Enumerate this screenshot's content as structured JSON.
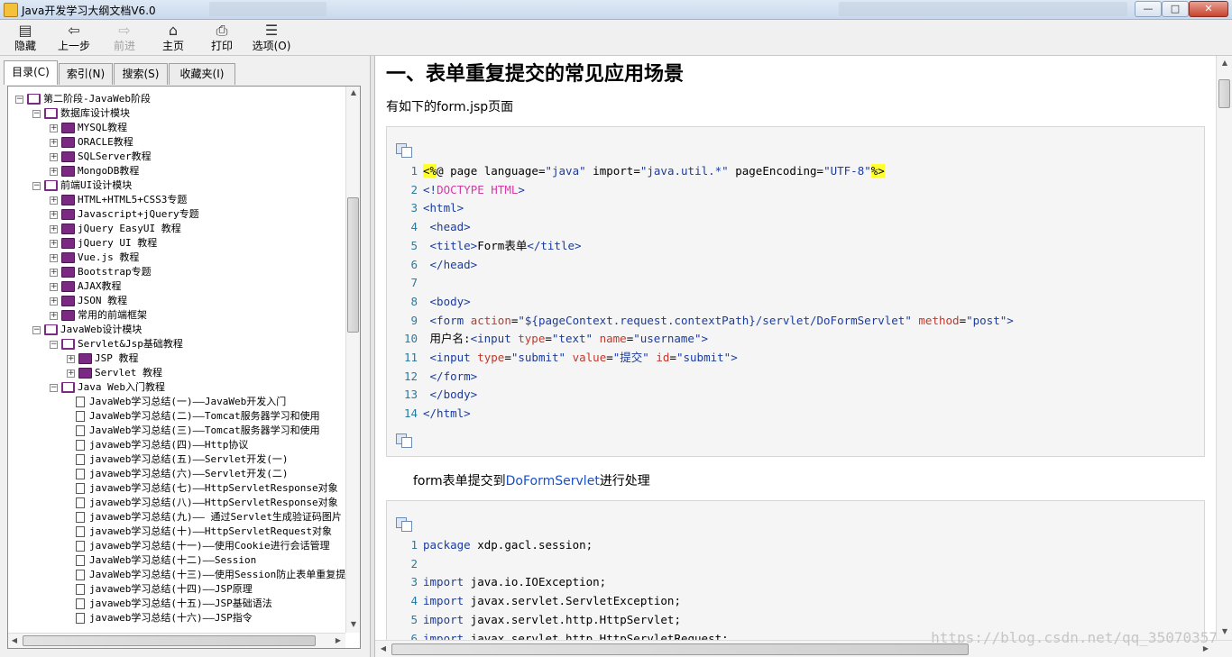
{
  "window": {
    "title": "Java开发学习大纲文档V6.0",
    "min": "—",
    "max": "□",
    "close": "✕"
  },
  "toolbar": [
    {
      "name": "hide",
      "label": "隐藏",
      "icon": "▤",
      "enabled": true
    },
    {
      "name": "back",
      "label": "上一步",
      "icon": "⇦",
      "enabled": true
    },
    {
      "name": "forward",
      "label": "前进",
      "icon": "⇨",
      "enabled": false
    },
    {
      "name": "home",
      "label": "主页",
      "icon": "⌂",
      "enabled": true
    },
    {
      "name": "print",
      "label": "打印",
      "icon": "⎙",
      "enabled": true
    },
    {
      "name": "options",
      "label": "选项(O)",
      "icon": "☰",
      "enabled": true
    }
  ],
  "tabs": [
    "目录(C)",
    "索引(N)",
    "搜索(S)",
    "收藏夹(I)"
  ],
  "tree": [
    {
      "level": 0,
      "type": "open",
      "exp": "−",
      "label": "第二阶段-JavaWeb阶段"
    },
    {
      "level": 1,
      "type": "open",
      "exp": "−",
      "label": "数据库设计模块"
    },
    {
      "level": 2,
      "type": "closed",
      "exp": "+",
      "label": "MYSQL教程"
    },
    {
      "level": 2,
      "type": "closed",
      "exp": "+",
      "label": "ORACLE教程"
    },
    {
      "level": 2,
      "type": "closed",
      "exp": "+",
      "label": "SQLServer教程"
    },
    {
      "level": 2,
      "type": "closed",
      "exp": "+",
      "label": "MongoDB教程"
    },
    {
      "level": 1,
      "type": "open",
      "exp": "−",
      "label": "前端UI设计模块"
    },
    {
      "level": 2,
      "type": "closed",
      "exp": "+",
      "label": "HTML+HTML5+CSS3专题"
    },
    {
      "level": 2,
      "type": "closed",
      "exp": "+",
      "label": "Javascript+jQuery专题"
    },
    {
      "level": 2,
      "type": "closed",
      "exp": "+",
      "label": "jQuery EasyUI 教程"
    },
    {
      "level": 2,
      "type": "closed",
      "exp": "+",
      "label": "jQuery UI 教程"
    },
    {
      "level": 2,
      "type": "closed",
      "exp": "+",
      "label": "Vue.js 教程"
    },
    {
      "level": 2,
      "type": "closed",
      "exp": "+",
      "label": "Bootstrap专题"
    },
    {
      "level": 2,
      "type": "closed",
      "exp": "+",
      "label": "AJAX教程"
    },
    {
      "level": 2,
      "type": "closed",
      "exp": "+",
      "label": "JSON 教程"
    },
    {
      "level": 2,
      "type": "closed",
      "exp": "+",
      "label": "常用的前端框架"
    },
    {
      "level": 1,
      "type": "open",
      "exp": "−",
      "label": "JavaWeb设计模块"
    },
    {
      "level": 2,
      "type": "open",
      "exp": "−",
      "label": "Servlet&Jsp基础教程"
    },
    {
      "level": 3,
      "type": "closed",
      "exp": "+",
      "label": "JSP 教程"
    },
    {
      "level": 3,
      "type": "closed",
      "exp": "+",
      "label": "Servlet 教程"
    },
    {
      "level": 2,
      "type": "open",
      "exp": "−",
      "label": "Java Web入门教程"
    },
    {
      "level": 3,
      "type": "doc",
      "label": "JavaWeb学习总结(一)——JavaWeb开发入门"
    },
    {
      "level": 3,
      "type": "doc",
      "label": "JavaWeb学习总结(二)——Tomcat服务器学习和使用"
    },
    {
      "level": 3,
      "type": "doc",
      "label": "JavaWeb学习总结(三)——Tomcat服务器学习和使用"
    },
    {
      "level": 3,
      "type": "doc",
      "label": "javaweb学习总结(四)——Http协议"
    },
    {
      "level": 3,
      "type": "doc",
      "label": "javaweb学习总结(五)——Servlet开发(一)"
    },
    {
      "level": 3,
      "type": "doc",
      "label": "javaweb学习总结(六)——Servlet开发(二)"
    },
    {
      "level": 3,
      "type": "doc",
      "label": "javaweb学习总结(七)——HttpServletResponse对象"
    },
    {
      "level": 3,
      "type": "doc",
      "label": "javaweb学习总结(八)——HttpServletResponse对象"
    },
    {
      "level": 3,
      "type": "doc",
      "label": "javaweb学习总结(九)—— 通过Servlet生成验证码图片"
    },
    {
      "level": 3,
      "type": "doc",
      "label": "javaweb学习总结(十)——HttpServletRequest对象"
    },
    {
      "level": 3,
      "type": "doc",
      "label": "javaweb学习总结(十一)——使用Cookie进行会话管理"
    },
    {
      "level": 3,
      "type": "doc",
      "label": "JavaWeb学习总结(十二)——Session"
    },
    {
      "level": 3,
      "type": "doc",
      "label": "JavaWeb学习总结(十三)——使用Session防止表单重复提交"
    },
    {
      "level": 3,
      "type": "doc",
      "label": "javaweb学习总结(十四)——JSP原理"
    },
    {
      "level": 3,
      "type": "doc",
      "label": "javaweb学习总结(十五)——JSP基础语法"
    },
    {
      "level": 3,
      "type": "doc",
      "label": "javaweb学习总结(十六)——JSP指令"
    }
  ],
  "content": {
    "heading": "一、表单重复提交的常见应用场景",
    "intro": "有如下的form.jsp页面",
    "code1": [
      [
        [
          "hl",
          "<%"
        ],
        [
          "",
          "@ page language="
        ],
        [
          "val",
          "\"java\""
        ],
        [
          "",
          " import="
        ],
        [
          "val",
          "\"java.util.*\""
        ],
        [
          "",
          " pageEncoding="
        ],
        [
          "val",
          "\"UTF-8\""
        ],
        [
          "hl",
          "%>"
        ]
      ],
      [
        [
          "tag",
          "<!"
        ],
        [
          "pink",
          "DOCTYPE HTML"
        ],
        [
          "tag",
          ">"
        ]
      ],
      [
        [
          "tag",
          "<html>"
        ]
      ],
      [
        [
          "",
          "  "
        ],
        [
          "tag",
          "<head>"
        ]
      ],
      [
        [
          "",
          "    "
        ],
        [
          "tag",
          "<title>"
        ],
        [
          "",
          "Form表单"
        ],
        [
          "tag",
          "</title>"
        ]
      ],
      [
        [
          "",
          "  "
        ],
        [
          "tag",
          "</head>"
        ]
      ],
      [],
      [
        [
          "",
          "  "
        ],
        [
          "tag",
          "<body>"
        ]
      ],
      [
        [
          "",
          "      "
        ],
        [
          "tag",
          "<form "
        ],
        [
          "atr",
          "action"
        ],
        [
          "",
          "="
        ],
        [
          "val",
          "\"${pageContext.request.contextPath}/servlet/DoFormServlet\""
        ],
        [
          "",
          " "
        ],
        [
          "atr",
          "method"
        ],
        [
          "",
          "="
        ],
        [
          "val",
          "\"post\""
        ],
        [
          "tag",
          ">"
        ]
      ],
      [
        [
          "",
          "        用户名:"
        ],
        [
          "tag",
          "<input "
        ],
        [
          "atr",
          "type"
        ],
        [
          "",
          "="
        ],
        [
          "val",
          "\"text\""
        ],
        [
          "",
          " "
        ],
        [
          "atr",
          "name"
        ],
        [
          "",
          "="
        ],
        [
          "val",
          "\"username\""
        ],
        [
          "tag",
          ">"
        ]
      ],
      [
        [
          "",
          "        "
        ],
        [
          "tag",
          "<input "
        ],
        [
          "atr",
          "type"
        ],
        [
          "",
          "="
        ],
        [
          "val",
          "\"submit\""
        ],
        [
          "",
          " "
        ],
        [
          "atr",
          "value"
        ],
        [
          "",
          "="
        ],
        [
          "val",
          "\"提交\""
        ],
        [
          "",
          " "
        ],
        [
          "atr",
          "id"
        ],
        [
          "",
          "="
        ],
        [
          "val",
          "\"submit\""
        ],
        [
          "tag",
          ">"
        ]
      ],
      [
        [
          "",
          "    "
        ],
        [
          "tag",
          "</form>"
        ]
      ],
      [
        [
          "",
          "  "
        ],
        [
          "tag",
          "</body>"
        ]
      ],
      [
        [
          "tag",
          "</html>"
        ]
      ]
    ],
    "mid_text": "form表单提交到",
    "mid_link": "DoFormServlet",
    "mid_tail": "进行处理",
    "code2": [
      [
        [
          "kw",
          "package"
        ],
        [
          "",
          " xdp.gacl.session;"
        ]
      ],
      [],
      [
        [
          "kw",
          "import"
        ],
        [
          "",
          " java.io.IOException;"
        ]
      ],
      [
        [
          "kw",
          "import"
        ],
        [
          "",
          " javax.servlet.ServletException;"
        ]
      ],
      [
        [
          "kw",
          "import"
        ],
        [
          "",
          " javax.servlet.http.HttpServlet;"
        ]
      ],
      [
        [
          "kw",
          "import"
        ],
        [
          "",
          " javax.servlet.http.HttpServletRequest;"
        ]
      ]
    ]
  },
  "watermark": "https://blog.csdn.net/qq_35070357"
}
